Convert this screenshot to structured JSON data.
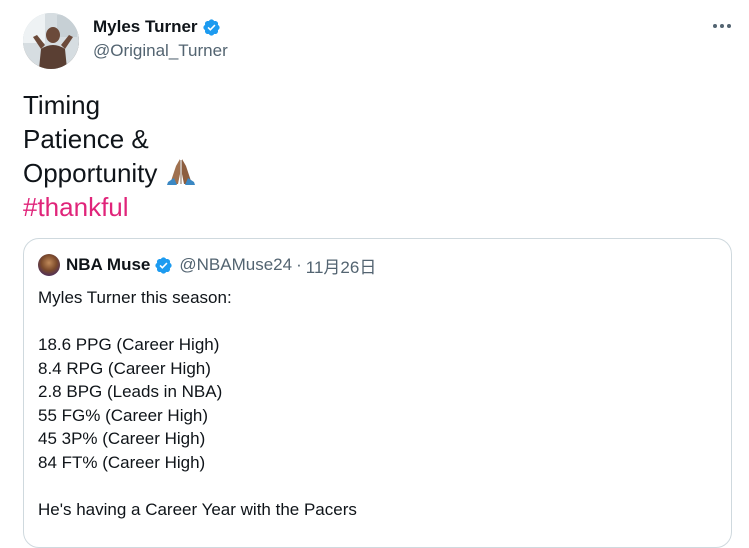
{
  "author": {
    "display_name": "Myles Turner",
    "handle": "@Original_Turner",
    "verified": true
  },
  "more_icon": "more-horizontal-icon",
  "tweet": {
    "lines": [
      "Timing",
      "Patience &",
      "Opportunity"
    ],
    "emoji": "🙏🏾",
    "hashtag": "#thankful"
  },
  "quoted_tweet": {
    "display_name": "NBA Muse",
    "handle": "@NBAMuse24",
    "separator": "·",
    "date": "11月26日",
    "verified": true,
    "lines": [
      "Myles Turner this season:",
      "",
      "18.6 PPG (Career High)",
      "8.4 RPG (Career High)",
      "2.8 BPG (Leads in NBA)",
      "55 FG% (Career High)",
      "45 3P% (Career High)",
      "84 FT% (Career High)",
      "",
      "He's having a Career Year with the Pacers"
    ]
  },
  "colors": {
    "verified_blue": "#1d9bf0",
    "hashtag_pink": "#e0247a",
    "secondary_text": "#536471",
    "border": "#cfd9de"
  }
}
